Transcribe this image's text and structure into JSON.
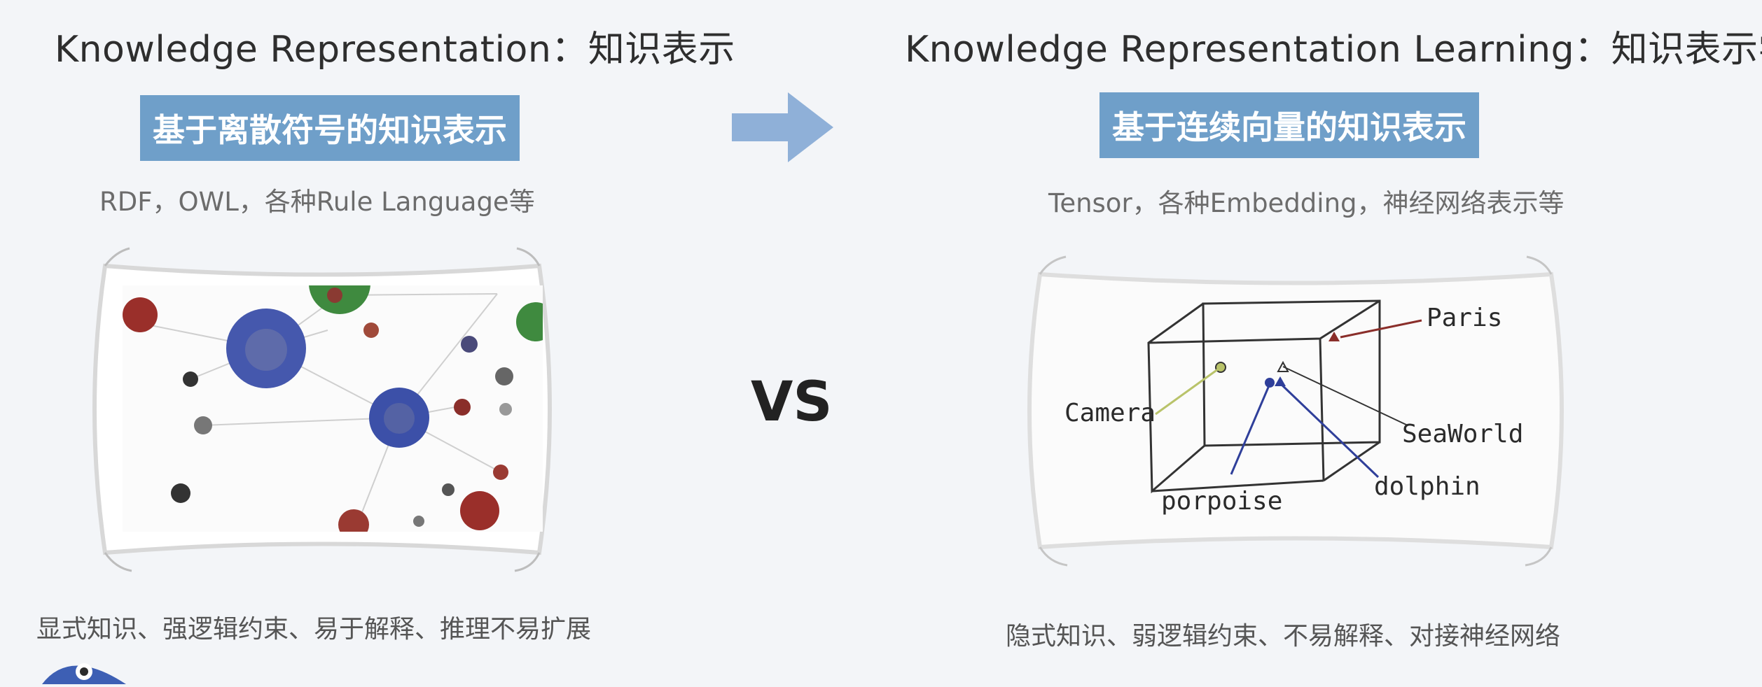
{
  "left": {
    "title": "Knowledge Representation：知识表示",
    "badge": "基于离散符号的知识表示",
    "subtitle": "RDF，OWL，各种Rule Language等",
    "caption": "显式知识、强逻辑约束、易于解释、推理不易扩展"
  },
  "right": {
    "title": "Knowledge Representation Learning：知识表示学习",
    "badge": "基于连续向量的知识表示",
    "subtitle": "Tensor，各种Embedding，神经网络表示等",
    "caption": "隐式知识、弱逻辑约束、不易解释、对接神经网络",
    "labels": {
      "paris": "Paris",
      "camera": "Camera",
      "seaworld": "SeaWorld",
      "dolphin": "dolphin",
      "porpoise": "porpoise"
    }
  },
  "center": {
    "vs": "VS"
  },
  "colors": {
    "badge_bg": "#6f9fc9",
    "arrow": "#8fb0d8",
    "node_blue": "#3f55a8",
    "node_red": "#9a2f2a",
    "node_green": "#3f8a3f"
  }
}
